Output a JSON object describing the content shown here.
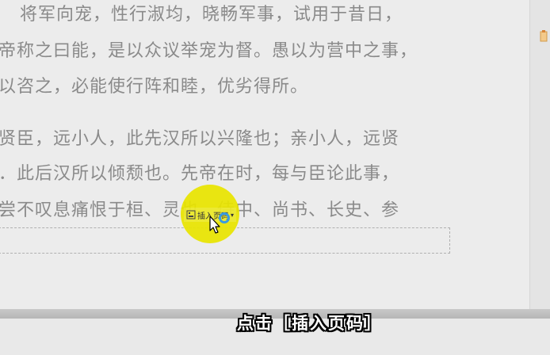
{
  "document": {
    "lines": [
      "将军向宠，性行淑均，晓畅军事，试用于昔日，",
      "帝称之曰能，是以众议举宠为督。愚以为营中之事，",
      "以咨之，必能使行阵和睦，优劣得所。",
      "贤臣，远小人，此先汉所以兴隆也；亲小人，远贤",
      "．此后汉所以倾颓也。先帝在时，每与臣论此事，",
      "尝不叹息痛恨于桓、灵也。侍中、尚书、长史、参"
    ]
  },
  "toolbar": {
    "insert_page_number_label": "插入页码",
    "insert_page_number_icon": "page-number-icon"
  },
  "caption": {
    "text": "点击［插入页码］"
  },
  "colors": {
    "highlight": "#e8e400",
    "click_ring": "#3a9be0",
    "body_text": "#8a8a8a"
  }
}
